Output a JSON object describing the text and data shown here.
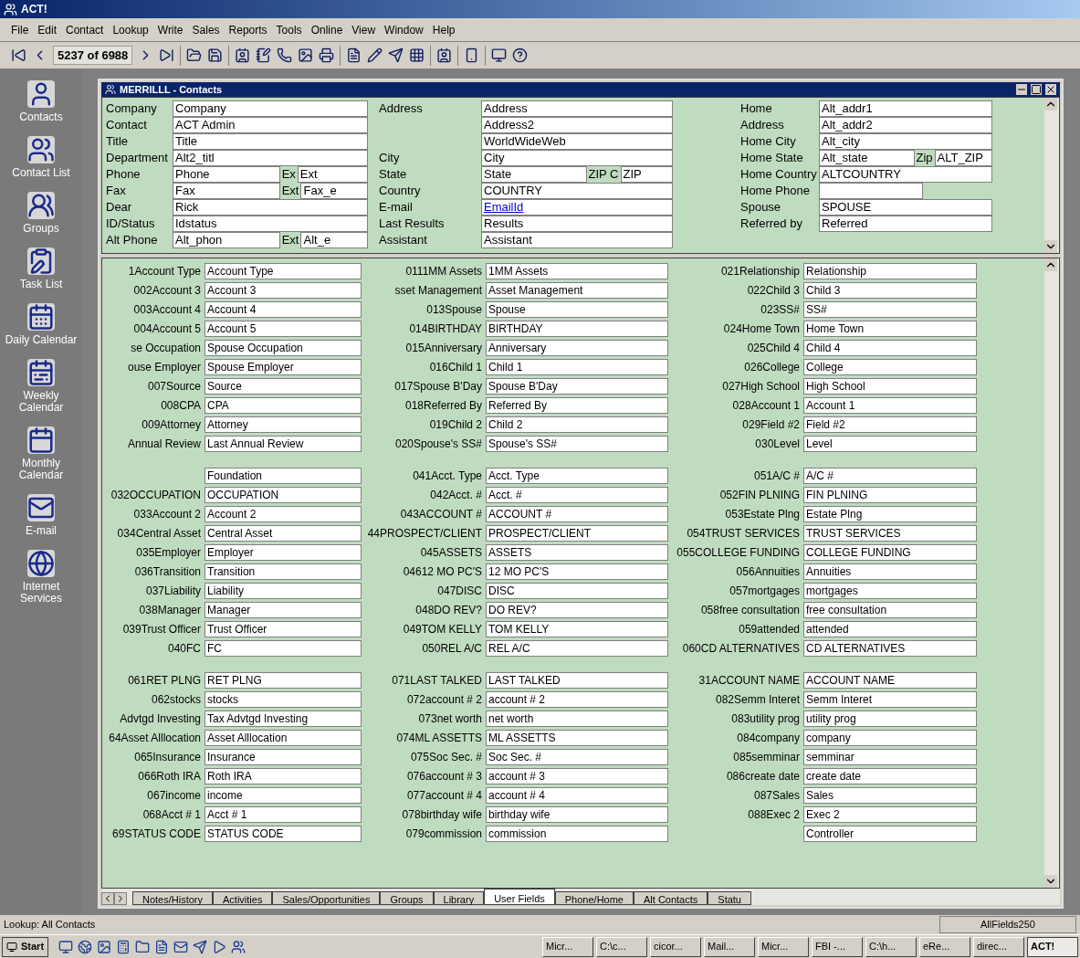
{
  "app": {
    "title": "ACT!"
  },
  "menu": [
    "File",
    "Edit",
    "Contact",
    "Lookup",
    "Write",
    "Sales",
    "Reports",
    "Tools",
    "Online",
    "View",
    "Window",
    "Help"
  ],
  "toolbar": {
    "record_counter": "5237 of 6988"
  },
  "sidebar": [
    {
      "label": "Contacts",
      "kind": "person"
    },
    {
      "label": "Contact List",
      "kind": "people"
    },
    {
      "label": "Groups",
      "kind": "groups"
    },
    {
      "label": "Task List",
      "kind": "task"
    },
    {
      "label": "Daily Calendar",
      "kind": "day"
    },
    {
      "label": "Weekly Calendar",
      "kind": "week"
    },
    {
      "label": "Monthly Calendar",
      "kind": "month"
    },
    {
      "label": "E-mail",
      "kind": "mail"
    },
    {
      "label": "Internet Services",
      "kind": "globe"
    }
  ],
  "window": {
    "title": "MERRILLL - Contacts"
  },
  "top_fields": [
    [
      {
        "label": "Company",
        "value": "Company"
      },
      {
        "label": "Contact",
        "value": "ACT Admin"
      },
      {
        "label": "Title",
        "value": "Title"
      },
      {
        "label": "Department",
        "value": "Alt2_titl"
      },
      {
        "label": "Phone",
        "value": "Phone",
        "ext_label": "Ex",
        "ext_value": "Ext"
      },
      {
        "label": "Fax",
        "value": "Fax",
        "ext_label": "Ext",
        "ext_value": "Fax_e"
      },
      {
        "label": "Dear",
        "value": "Rick"
      },
      {
        "label": "ID/Status",
        "value": "Idstatus"
      },
      {
        "label": "Alt Phone",
        "value": "Alt_phon",
        "ext_label": "Ext",
        "ext_value": "Alt_e"
      }
    ],
    [
      {
        "label": "Address",
        "value": "Address",
        "link": false
      },
      {
        "value": "Address2",
        "link": false
      },
      {
        "value": "WorldWideWeb",
        "link": false
      },
      {
        "label": "City",
        "value": "City",
        "link": false
      },
      {
        "label": "State",
        "value": "State",
        "ext_label": "ZIP C",
        "ext_value": "ZIP",
        "link": false
      },
      {
        "label": "Country",
        "value": "COUNTRY",
        "link": false
      },
      {
        "label": "E-mail",
        "value": "EmailId",
        "link": true
      },
      {
        "label": "Last Results",
        "value": "Results",
        "link": false
      },
      {
        "label": "Assistant",
        "value": "Assistant",
        "link": false
      }
    ],
    [
      {
        "label": "Home",
        "value": "Alt_addr1"
      },
      {
        "label": "Address",
        "value": "Alt_addr2"
      },
      {
        "label": "Home City",
        "value": "Alt_city"
      },
      {
        "label": "Home State",
        "value": "Alt_state",
        "ext_label": "Zip",
        "ext_value": "ALT_ZIP"
      },
      {
        "label": "Home Country",
        "value": "ALTCOUNTRY"
      },
      {
        "label": "Home Phone"
      },
      {
        "label": "Spouse",
        "value": "SPOUSE"
      },
      {
        "label": "Referred by",
        "value": "Referred"
      }
    ]
  ],
  "user_fields": [
    [
      [
        [
          "1Account Type",
          "Account Type"
        ],
        [
          "002Account 3",
          "Account 3"
        ],
        [
          "003Account 4",
          "Account 4"
        ],
        [
          "004Account 5",
          "Account 5"
        ],
        [
          "se Occupation",
          "Spouse Occupation"
        ],
        [
          "ouse Employer",
          "Spouse Employer"
        ],
        [
          "007Source",
          "Source"
        ],
        [
          "008CPA",
          "CPA"
        ],
        [
          "009Attorney",
          "Attorney"
        ],
        [
          "Annual Review",
          "Last Annual Review"
        ]
      ],
      [
        [
          "Foundation"
        ],
        [
          "032OCCUPATION",
          "OCCUPATION"
        ],
        [
          "033Account 2",
          "Account 2"
        ],
        [
          "034Central Asset",
          "Central Asset"
        ],
        [
          "035Employer",
          "Employer"
        ],
        [
          "036Transition",
          "Transition"
        ],
        [
          "037Liability",
          "Liability"
        ],
        [
          "038Manager",
          "Manager"
        ],
        [
          "039Trust Officer",
          "Trust Officer"
        ],
        [
          "040FC",
          "FC"
        ]
      ],
      [
        [
          "061RET PLNG",
          "RET PLNG"
        ],
        [
          "062stocks",
          "stocks"
        ],
        [
          "Advtgd Investing",
          "Tax Advtgd Investing"
        ],
        [
          "64Asset Alllocation",
          "Asset Alllocation"
        ],
        [
          "065Insurance",
          "Insurance"
        ],
        [
          "066Roth IRA",
          "Roth IRA"
        ],
        [
          "067income",
          "income"
        ],
        [
          "068Acct # 1",
          "Acct # 1"
        ],
        [
          "69STATUS CODE",
          "STATUS CODE"
        ]
      ]
    ],
    [
      [
        [
          "0111MM Assets",
          "1MM Assets"
        ],
        [
          "sset Management",
          "Asset Management"
        ],
        [
          "013Spouse",
          "Spouse"
        ],
        [
          "014BIRTHDAY",
          "BIRTHDAY"
        ],
        [
          "015Anniversary",
          "Anniversary"
        ],
        [
          "016Child 1",
          "Child 1"
        ],
        [
          "017Spouse B'Day",
          "Spouse B'Day"
        ],
        [
          "018Referred By",
          "Referred By"
        ],
        [
          "019Child 2",
          "Child 2"
        ],
        [
          "020Spouse's SS#",
          "Spouse's SS#"
        ]
      ],
      [
        [
          "041Acct. Type",
          "Acct. Type"
        ],
        [
          "042Acct. #",
          "Acct. #"
        ],
        [
          "043ACCOUNT #",
          "ACCOUNT #"
        ],
        [
          "44PROSPECT/CLIENT",
          "PROSPECT/CLIENT"
        ],
        [
          "045ASSETS",
          "ASSETS"
        ],
        [
          "04612 MO PC'S",
          "12 MO PC'S"
        ],
        [
          "047DISC",
          "DISC"
        ],
        [
          "048DO REV?",
          "DO REV?"
        ],
        [
          "049TOM KELLY",
          "TOM KELLY"
        ],
        [
          "050REL A/C",
          "REL A/C"
        ]
      ],
      [
        [
          "071LAST TALKED",
          "LAST TALKED"
        ],
        [
          "072account # 2",
          "account # 2"
        ],
        [
          "073net worth",
          "net worth"
        ],
        [
          "074ML ASSETTS",
          "ML ASSETTS"
        ],
        [
          "075Soc Sec. #",
          "Soc Sec. #"
        ],
        [
          "076account # 3",
          "account # 3"
        ],
        [
          "077account # 4",
          "account # 4"
        ],
        [
          "078birthday wife",
          "birthday wife"
        ],
        [
          "079commission",
          "commission"
        ]
      ]
    ],
    [
      [
        [
          "021Relationship",
          "Relationship"
        ],
        [
          "022Child 3",
          "Child 3"
        ],
        [
          "023SS#",
          "SS#"
        ],
        [
          "024Home Town",
          "Home Town"
        ],
        [
          "025Child 4",
          "Child 4"
        ],
        [
          "026College",
          "College"
        ],
        [
          "027High School",
          "High School"
        ],
        [
          "028Account 1",
          "Account 1"
        ],
        [
          "029Field #2",
          "Field #2"
        ],
        [
          "030Level",
          "Level"
        ]
      ],
      [
        [
          "051A/C #",
          "A/C #"
        ],
        [
          "052FIN PLNING",
          "FIN PLNING"
        ],
        [
          "053Estate Plng",
          "Estate Plng"
        ],
        [
          "054TRUST SERVICES",
          "TRUST SERVICES"
        ],
        [
          "055COLLEGE FUNDING",
          "COLLEGE FUNDING"
        ],
        [
          "056Annuities",
          "Annuities"
        ],
        [
          "057mortgages",
          "mortgages"
        ],
        [
          "058free consultation",
          "free consultation"
        ],
        [
          "059attended",
          "attended"
        ],
        [
          "060CD ALTERNATIVES",
          "CD ALTERNATIVES"
        ]
      ],
      [
        [
          "31ACCOUNT NAME",
          "ACCOUNT NAME"
        ],
        [
          "082Semm Interet",
          "Semm Interet"
        ],
        [
          "083utility prog",
          "utility prog"
        ],
        [
          "084company",
          "company"
        ],
        [
          "085semminar",
          "semminar"
        ],
        [
          "086create date",
          "create date"
        ],
        [
          "087Sales",
          "Sales"
        ],
        [
          "088Exec 2",
          "Exec 2"
        ],
        [
          "Controller"
        ]
      ]
    ]
  ],
  "tabs": [
    {
      "label": "Notes/History",
      "selected": false
    },
    {
      "label": "Activities",
      "selected": false
    },
    {
      "label": "Sales/Opportunities",
      "selected": false
    },
    {
      "label": "Groups",
      "selected": false
    },
    {
      "label": "Library",
      "selected": false
    },
    {
      "label": "User Fields",
      "selected": true
    },
    {
      "label": "Phone/Home",
      "selected": false
    },
    {
      "label": "Alt Contacts",
      "selected": false
    },
    {
      "label": "Statu",
      "selected": false
    }
  ],
  "status_bar": {
    "lookup": "Lookup: All Contacts",
    "layout": "AllFields250"
  },
  "taskbar": {
    "start": "Start",
    "tasks": [
      {
        "label": "Micr...",
        "selected": false
      },
      {
        "label": "C:\\c...",
        "selected": false
      },
      {
        "label": "cicor...",
        "selected": false
      },
      {
        "label": "Mail...",
        "selected": false
      },
      {
        "label": "Micr...",
        "selected": false
      },
      {
        "label": "FBI -...",
        "selected": false
      },
      {
        "label": "C:\\h...",
        "selected": false
      },
      {
        "label": "eRe...",
        "selected": false
      },
      {
        "label": "direc...",
        "selected": false
      },
      {
        "label": "ACT!",
        "selected": true
      }
    ]
  }
}
